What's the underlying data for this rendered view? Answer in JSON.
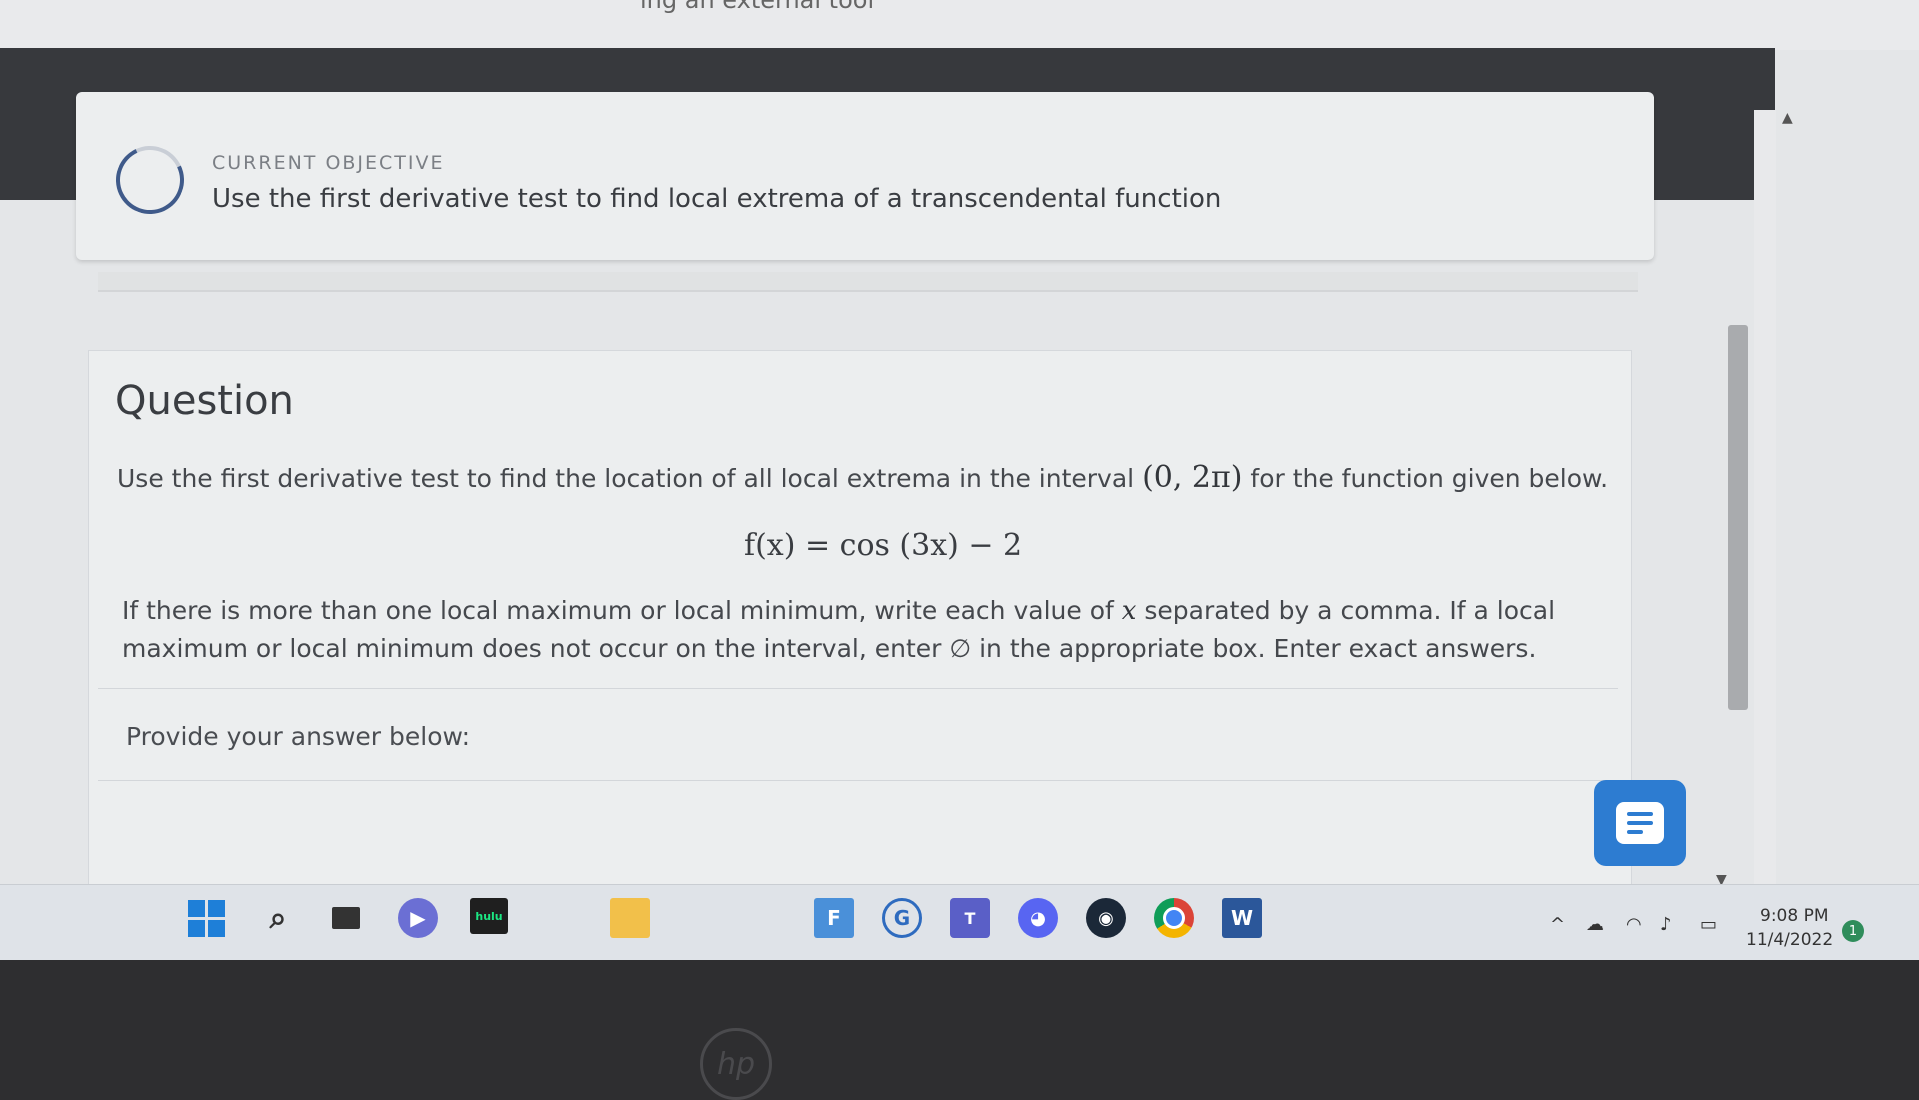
{
  "window": {
    "partial_title": "ing an external tool"
  },
  "objective": {
    "label": "CURRENT OBJECTIVE",
    "text": "Use the first derivative test to find local extrema of a transcendental function"
  },
  "question": {
    "title": "Question",
    "line1_before": "Use the first derivative test to find the location of all local extrema in the interval",
    "interval": "(0, 2π)",
    "line1_after": "for the function given below.",
    "formula": "f(x) = cos (3x) − 2",
    "line2_a": "If there is more than one local maximum or local minimum, write each value of",
    "line2_var": "x",
    "line2_b": "separated by a comma. If a local maximum or local minimum does not occur on the interval, enter ∅ in the appropriate box. Enter exact answers.",
    "provide": "Provide your answer below:"
  },
  "taskbar": {
    "hulu_label": "hulu",
    "time": "9:08 PM",
    "date": "11/4/2022",
    "notification_count": "1"
  },
  "colors": {
    "accent": "#2d7cd1",
    "dark_header": "#37393d",
    "card_bg": "#eceeef"
  }
}
